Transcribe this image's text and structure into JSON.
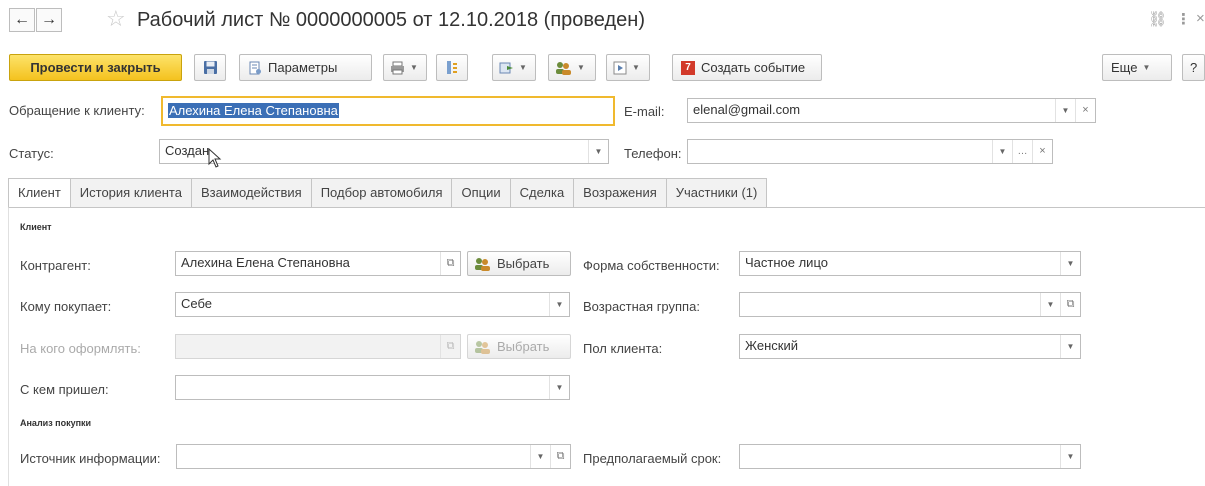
{
  "window": {
    "title": "Рабочий лист № 0000000005  от 12.10.2018 (проведен)",
    "back_icon": "←",
    "forward_icon": "→",
    "favorite_icon": "☆",
    "link_icon": "⛓",
    "menu_icon": "⋮",
    "close_icon": "×"
  },
  "toolbar": {
    "post_close_label": "Провести и закрыть",
    "params_label": "Параметры",
    "create_event_label": "Создать событие",
    "create_event_number": "7",
    "more_label": "Еще",
    "help_label": "?"
  },
  "header": {
    "client_address_label": "Обращение к клиенту:",
    "client_address_value": "Алехина Елена Степановна",
    "status_label": "Статус:",
    "status_value": "Создан",
    "email_label": "E-mail:",
    "email_value": "elenal@gmail.com",
    "phone_label": "Телефон:",
    "phone_value": ""
  },
  "tabs": [
    {
      "label": "Клиент"
    },
    {
      "label": "История клиента"
    },
    {
      "label": "Взаимодействия"
    },
    {
      "label": "Подбор автомобиля"
    },
    {
      "label": "Опции"
    },
    {
      "label": "Сделка"
    },
    {
      "label": "Возражения"
    },
    {
      "label": "Участники (1)"
    }
  ],
  "client_group": {
    "title": "Клиент",
    "counterparty_label": "Контрагент:",
    "counterparty_value": "Алехина Елена Степановна",
    "select_label": "Выбрать",
    "buyer_for_label": "Кому покупает:",
    "buyer_for_value": "Себе",
    "register_to_label": "На кого оформлять:",
    "register_to_value": "",
    "came_with_label": "С кем пришел:",
    "came_with_value": "",
    "ownership_label": "Форма собственности:",
    "ownership_value": "Частное лицо",
    "age_group_label": "Возрастная группа:",
    "age_group_value": "",
    "gender_label": "Пол клиента:",
    "gender_value": "Женский"
  },
  "purchase_group": {
    "title": "Анализ покупки",
    "info_source_label": "Источник информации:",
    "info_source_value": "",
    "expected_term_label": "Предполагаемый срок:",
    "expected_term_value": ""
  },
  "colors": {
    "primary_button": "#f4c21e",
    "selection": "#3b6fb6",
    "focus_border": "#f0b92e"
  }
}
